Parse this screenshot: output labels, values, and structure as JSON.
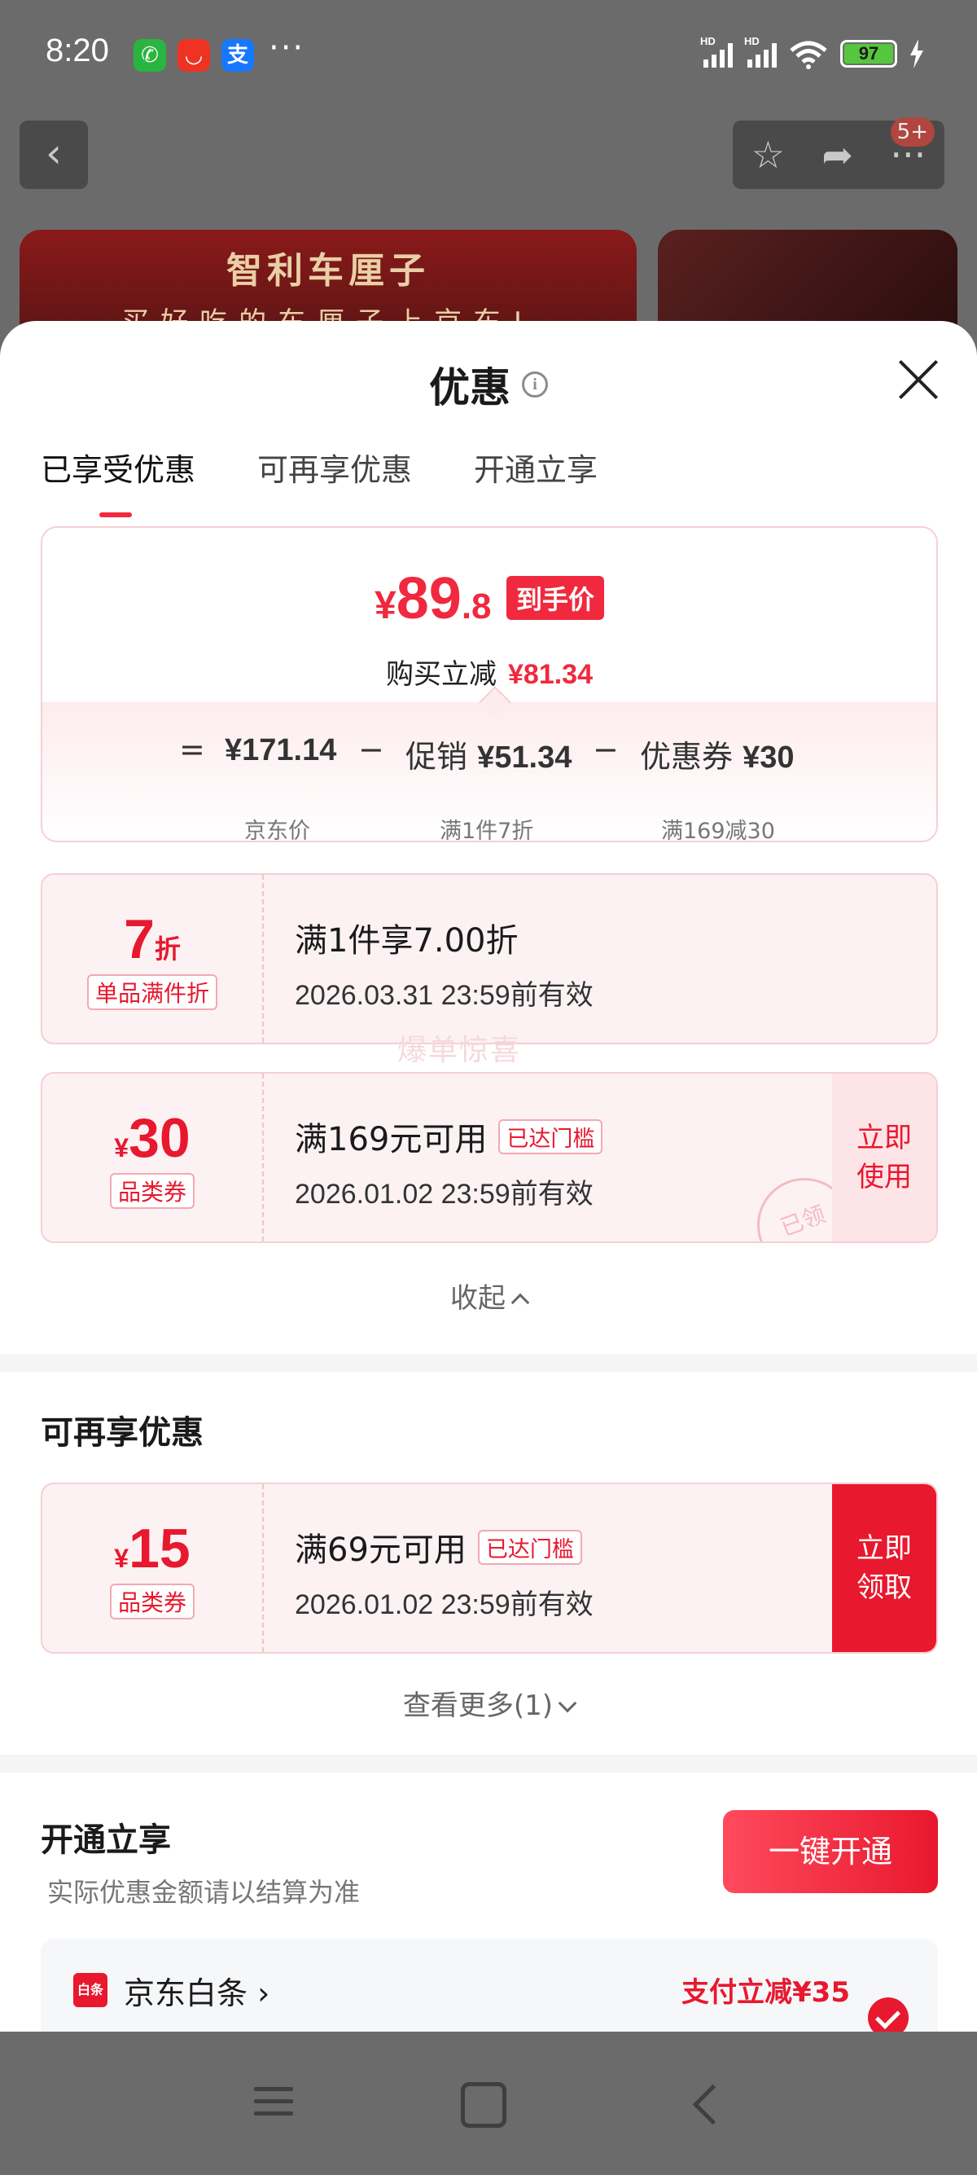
{
  "status_bar": {
    "time": "8:20",
    "apps": [
      {
        "name": "wechat",
        "glyph": "✆",
        "color": "#2ab540"
      },
      {
        "name": "taobao",
        "glyph": "◡",
        "color": "#ee3322"
      },
      {
        "name": "alipay",
        "glyph": "支",
        "color": "#1677ff"
      }
    ],
    "more": "···",
    "signal_label": "HD",
    "battery": "97"
  },
  "background_page": {
    "badge": "5+",
    "banner_title": "智利车厘子",
    "banner_sub": "买好吃的车厘子上京东!"
  },
  "sheet": {
    "title": "优惠",
    "tabs": [
      "已享受优惠",
      "可再享优惠",
      "开通立享"
    ]
  },
  "summary": {
    "yen": "¥",
    "price_int": "89",
    "price_dec": ".8",
    "price_tag": "到手价",
    "reduce_label": "购买立减",
    "reduce_amount": "¥81.34",
    "eq": "=",
    "minus": "−",
    "jd_price": "¥171.14",
    "jd_price_label": "京东价",
    "promo_label": "促销",
    "promo_amount": "¥51.34",
    "promo_sub": "满1件7折",
    "coupon_label": "优惠券",
    "coupon_amount": "¥30",
    "coupon_sub": "满169减30"
  },
  "enjoyed": [
    {
      "value": "7",
      "suffix": "折",
      "label": "单品满件折",
      "title": "满1件享7.00折",
      "date": "2026.03.31 23:59前有效"
    },
    {
      "prefix": "¥",
      "value": "30",
      "label": "品类券",
      "title": "满169元可用",
      "flag": "已达门槛",
      "date": "2026.01.02 23:59前有效",
      "action": "立即\n使用",
      "stamp": "已领"
    }
  ],
  "watermark": "爆单惊喜",
  "collapse_label": "收起",
  "more_section": {
    "title": "可再享优惠",
    "coupon": {
      "prefix": "¥",
      "value": "15",
      "label": "品类券",
      "title": "满69元可用",
      "flag": "已达门槛",
      "date": "2026.01.02 23:59前有效",
      "action": "立即\n领取"
    },
    "see_more": "查看更多(1)"
  },
  "open_section": {
    "title": "开通立享",
    "subtitle": "实际优惠金额请以结算为准",
    "button": "一键开通",
    "pay_logo": "白条",
    "pay_name": "京东白条 ›",
    "pay_offer": "支付立减¥35"
  }
}
